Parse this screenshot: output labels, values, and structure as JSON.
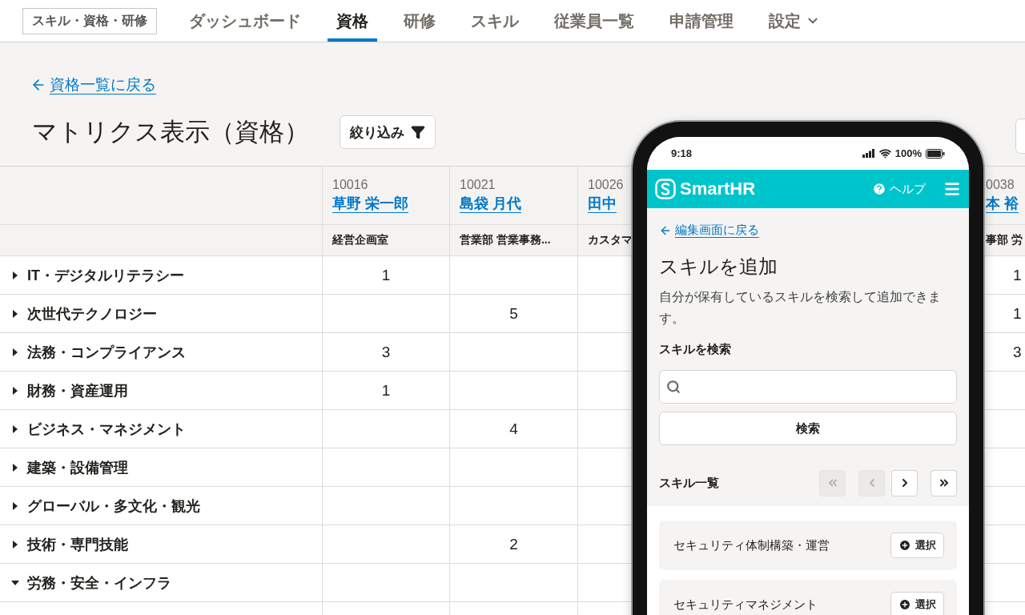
{
  "app_switcher": {
    "label": "スキル・資格・研修"
  },
  "nav": [
    {
      "label": "ダッシュボード",
      "selected": false,
      "kind": "link"
    },
    {
      "label": "資格",
      "selected": true,
      "kind": "link"
    },
    {
      "label": "研修",
      "selected": false,
      "kind": "link"
    },
    {
      "label": "スキル",
      "selected": false,
      "kind": "link"
    },
    {
      "label": "従業員一覧",
      "selected": false,
      "kind": "link"
    },
    {
      "label": "申請管理",
      "selected": false,
      "kind": "link"
    },
    {
      "label": "設定",
      "selected": false,
      "kind": "dropdown"
    }
  ],
  "back_link": "資格一覧に戻る",
  "title": "マトリクス表示（資格）",
  "filter_button": "絞り込み",
  "matrix": {
    "columns": [
      {
        "number": "10016",
        "name": "草野 栄一郎",
        "department": "経営企画室"
      },
      {
        "number": "10021",
        "name": "島袋 月代",
        "department": "営業部 営業事務..."
      },
      {
        "number": "10026",
        "name": "田中",
        "department": "カスタマ"
      },
      {
        "number": "0038",
        "name": "本 裕",
        "department": "事部 労"
      }
    ],
    "rows": [
      {
        "label": "IT・デジタルリテラシー",
        "expanded": false,
        "counts": {
          "column_1": "1",
          "column_4": "1"
        }
      },
      {
        "label": "次世代テクノロジー",
        "expanded": false,
        "counts": {
          "column_2": "5",
          "column_4": "1"
        }
      },
      {
        "label": "法務・コンプライアンス",
        "expanded": false,
        "counts": {
          "column_1": "3",
          "column_4": "3"
        }
      },
      {
        "label": "財務・資産運用",
        "expanded": false,
        "counts": {
          "column_1": "1"
        }
      },
      {
        "label": "ビジネス・マネジメント",
        "expanded": false,
        "counts": {
          "column_2": "4"
        }
      },
      {
        "label": "建築・設備管理",
        "expanded": false
      },
      {
        "label": "グローバル・多文化・観光",
        "expanded": false
      },
      {
        "label": "技術・専門技能",
        "expanded": false,
        "counts": {
          "column_2": "2"
        }
      },
      {
        "label": "労務・安全・インフラ",
        "expanded": true
      }
    ]
  },
  "phone": {
    "status": {
      "time": "9:18",
      "battery": "100%"
    },
    "header": {
      "logo": "SmartHR",
      "help": "ヘルプ"
    },
    "back_link": "編集画面に戻る",
    "title": "スキルを追加",
    "description": "自分が保有しているスキルを検索して追加できます。",
    "search_label": "スキルを検索",
    "search_button": "検索",
    "list_title": "スキル一覧",
    "pagination": [
      {
        "kind": "first",
        "disabled": true
      },
      {
        "kind": "prev",
        "disabled": true
      },
      {
        "kind": "next",
        "disabled": false
      },
      {
        "kind": "last",
        "disabled": false
      }
    ],
    "skills": [
      {
        "name": "セキュリティ体制構築・運営",
        "action": "選択"
      },
      {
        "name": "セキュリティマネジメント",
        "action": "選択"
      }
    ]
  }
}
